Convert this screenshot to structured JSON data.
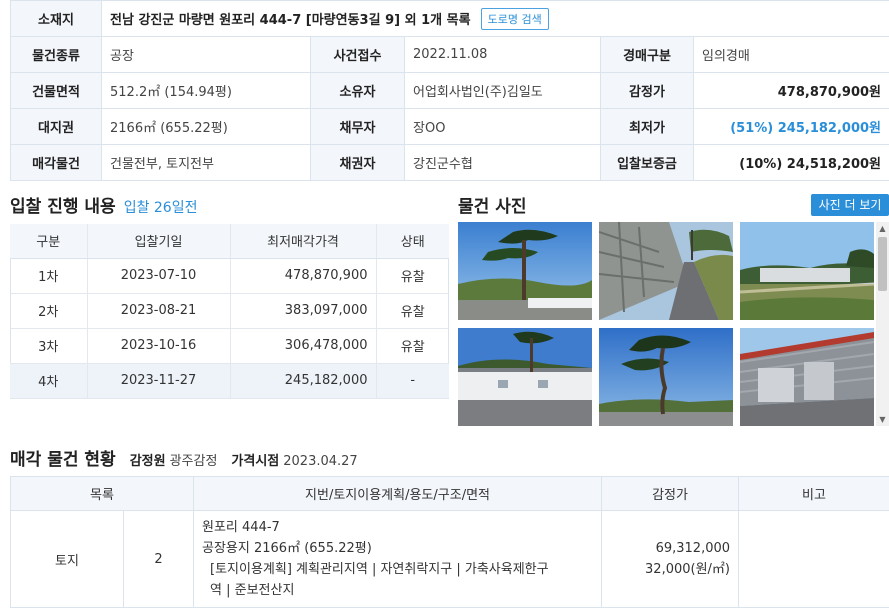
{
  "info": {
    "address_label": "소재지",
    "address": "전남 강진군 마량면 원포리 444-7 [마량연동3길 9] 외 1개 목록",
    "road_button": "도로명 검색",
    "rows": [
      [
        {
          "label": "물건종류"
        },
        {
          "value": "공장"
        },
        {
          "label": "사건접수"
        },
        {
          "value": "2022.11.08"
        },
        {
          "label": "경매구분"
        },
        {
          "value": "임의경매"
        }
      ],
      [
        {
          "label": "건물면적"
        },
        {
          "value": "512.2㎡ (154.94평)"
        },
        {
          "label": "소유자"
        },
        {
          "value": "어업회사법인(주)김일도"
        },
        {
          "label": "감정가"
        },
        {
          "value": "478,870,900원"
        }
      ],
      [
        {
          "label": "대지권"
        },
        {
          "value": "2166㎡ (655.22평)"
        },
        {
          "label": "채무자"
        },
        {
          "value": "장OO"
        },
        {
          "label": "최저가"
        },
        {
          "value": "(51%) 245,182,000원"
        }
      ],
      [
        {
          "label": "매각물건"
        },
        {
          "value": "건물전부, 토지전부"
        },
        {
          "label": "채권자"
        },
        {
          "value": "강진군수협"
        },
        {
          "label": "입찰보증금"
        },
        {
          "value": "(10%) 24,518,200원"
        }
      ]
    ]
  },
  "bidding": {
    "title": "입찰 진행 내용",
    "subtitle": "입찰 26일전",
    "headers": [
      "구분",
      "입찰기일",
      "최저매각가격",
      "상태"
    ],
    "rows": [
      [
        "1차",
        "2023-07-10",
        "478,870,900",
        "유찰"
      ],
      [
        "2차",
        "2023-08-21",
        "383,097,000",
        "유찰"
      ],
      [
        "3차",
        "2023-10-16",
        "306,478,000",
        "유찰"
      ],
      [
        "4차",
        "2023-11-27",
        "245,182,000",
        "-"
      ]
    ]
  },
  "photos": {
    "title": "물건 사진",
    "more_button": "사진 더 보기",
    "items": [
      "pine-tree-lot",
      "stone-wall-road",
      "fenced-field",
      "white-building-pine",
      "large-pine-tree",
      "metal-warehouse"
    ]
  },
  "sale": {
    "title": "매각 물건 현황",
    "appraiser_label": "감정원",
    "appraiser": "광주감정",
    "price_date_label": "가격시점",
    "price_date": "2023.04.27",
    "headers": [
      "목록",
      "지번/토지이용계획/용도/구조/면적",
      "감정가",
      "비고"
    ],
    "row": {
      "type": "토지",
      "no": "2",
      "lines": [
        "원포리 444-7",
        "공장용지 2166㎡ (655.22평)",
        "[토지이용계획] 계획관리지역 | 자연취락지구 | 가축사육제한구",
        "역 | 준보전산지"
      ],
      "price": "69,312,000",
      "unit_price": "32,000(원/㎡)",
      "note": ""
    }
  },
  "colors": {
    "accent": "#2a8fd8",
    "label_bg": "#f3f6fa",
    "border": "#dbe3ec"
  }
}
